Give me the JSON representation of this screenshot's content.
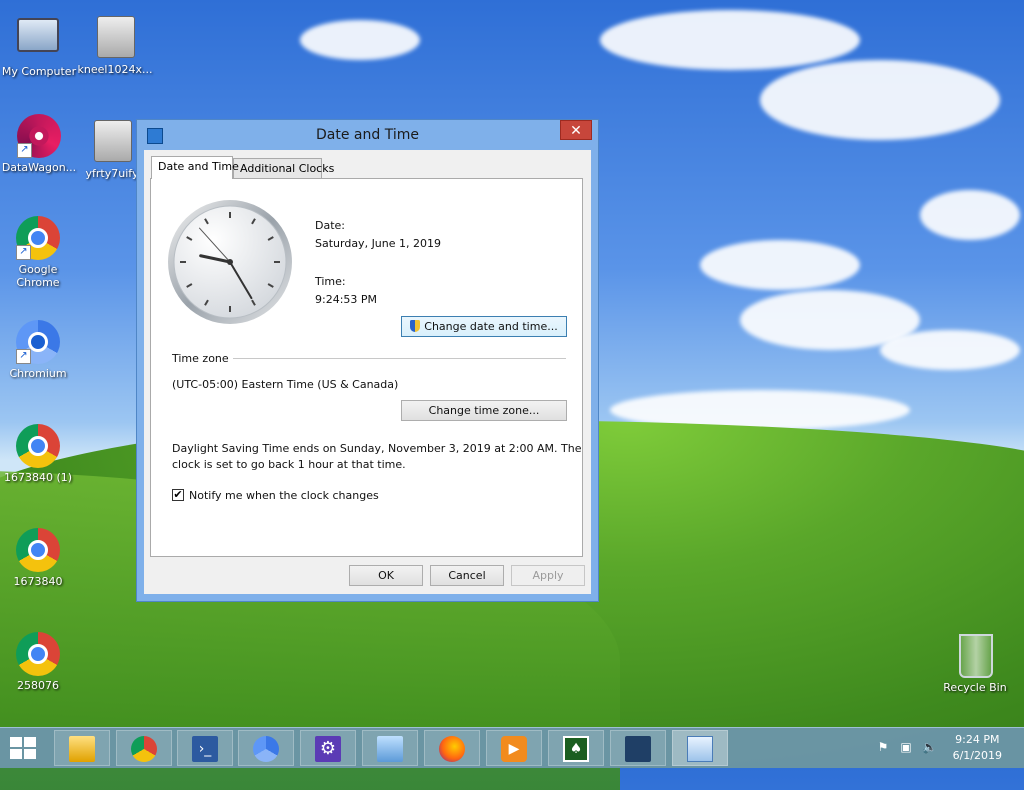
{
  "desktop": {
    "icons": [
      {
        "label": "My Computer"
      },
      {
        "label": "kneel1024x..."
      },
      {
        "label": "DataWagon..."
      },
      {
        "label": "yfrty7uify"
      },
      {
        "label": "Google Chrome"
      },
      {
        "label": "Chromium"
      },
      {
        "label": "1673840 (1)"
      },
      {
        "label": "1673840"
      },
      {
        "label": "258076"
      },
      {
        "label": "Recycle Bin"
      }
    ]
  },
  "dialog": {
    "title": "Date and Time",
    "close_glyph": "✕",
    "tabs": [
      {
        "label": "Date and Time",
        "active": true
      },
      {
        "label": "Additional Clocks",
        "active": false
      }
    ],
    "date_label": "Date:",
    "date_value": "Saturday, June 1, 2019",
    "time_label": "Time:",
    "time_value": "9:24:53 PM",
    "change_datetime_button": "Change date and time...",
    "timezone_group": "Time zone",
    "timezone_value": "(UTC-05:00) Eastern Time (US & Canada)",
    "change_timezone_button": "Change time zone...",
    "dst_line1": "Daylight Saving Time ends on Sunday, November 3, 2019 at 2:00 AM. The",
    "dst_line2": "clock is set to go back 1 hour at that time.",
    "notify_checkbox_label": "Notify me when the clock changes",
    "notify_checked": true,
    "check_glyph": "✔",
    "ok_button": "OK",
    "cancel_button": "Cancel",
    "apply_button": "Apply"
  },
  "taskbar": {
    "items": [
      {
        "icon": "file-explorer-icon"
      },
      {
        "icon": "chrome-icon"
      },
      {
        "icon": "powershell-icon"
      },
      {
        "icon": "chromium-icon"
      },
      {
        "icon": "settings-gear-icon"
      },
      {
        "icon": "control-panel-icon"
      },
      {
        "icon": "firefox-icon"
      },
      {
        "icon": "media-player-icon"
      },
      {
        "icon": "solitaire-icon"
      },
      {
        "icon": "app-icon"
      },
      {
        "icon": "date-time-icon"
      }
    ],
    "clock_time": "9:24 PM",
    "clock_date": "6/1/2019"
  }
}
